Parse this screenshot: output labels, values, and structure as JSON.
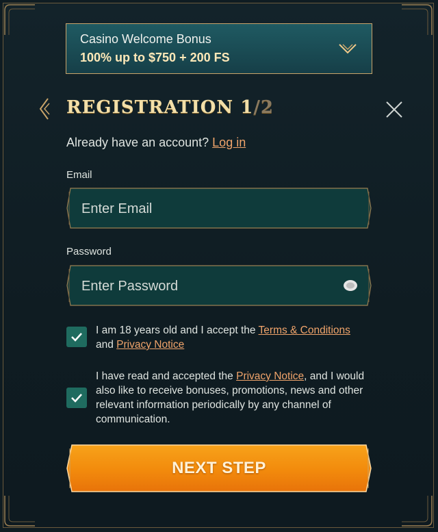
{
  "bonus": {
    "title": "Casino Welcome Bonus",
    "offer": "100% up to $750 + 200 FS"
  },
  "header": {
    "title": "REGISTRATION 1",
    "step_total": "/2"
  },
  "login": {
    "prompt": "Already have an account?",
    "link": "Log in"
  },
  "email": {
    "label": "Email",
    "placeholder": "Enter Email",
    "value": ""
  },
  "password": {
    "label": "Password",
    "placeholder": "Enter Password",
    "value": ""
  },
  "consent_terms": {
    "checked": true,
    "text_before": "I am 18 years old and I accept the ",
    "terms_link": "Terms & Conditions",
    "text_mid": " and ",
    "privacy_link": "Privacy Notice"
  },
  "consent_marketing": {
    "checked": true,
    "text_before": "I have read and accepted the ",
    "privacy_link": "Privacy Notice",
    "text_after": ", and I would also like to receive bonuses, promotions, news and other relevant information periodically by any channel of communication."
  },
  "next_button": {
    "label": "NEXT STEP"
  },
  "colors": {
    "accent_gold": "#c9a46a",
    "link_orange": "#f0a46b",
    "checkbox_green": "#1f6b5f",
    "button_orange": "#f28a0c"
  }
}
